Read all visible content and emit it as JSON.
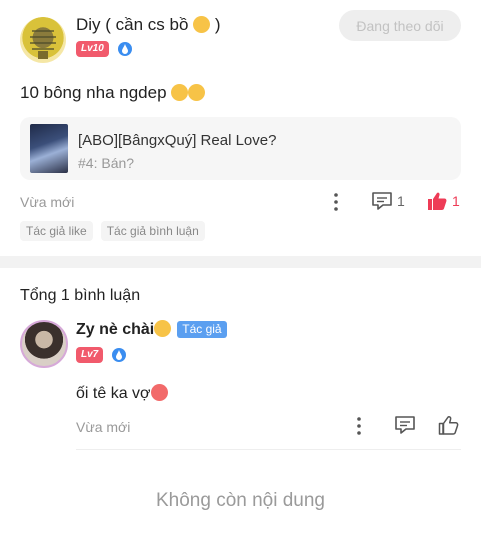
{
  "post": {
    "author_name": "Diy ( cần cs bồ",
    "author_name_suffix": ")",
    "author_level": "Lv10",
    "follow_label": "Đang theo dõi",
    "content": "10 bông nha ngdep",
    "book": {
      "title": "[ABO][BângxQuý] Real Love?",
      "chapter": "#4: Bán?"
    },
    "time": "Vừa mới",
    "comment_count": "1",
    "like_count": "1",
    "tags": [
      "Tác giả like",
      "Tác giả bình luận"
    ]
  },
  "comments_header": "Tổng 1 bình luận",
  "comment": {
    "author_name": "Zy nè chài",
    "author_tag": "Tác giả",
    "author_level": "Lv7",
    "content": "ối tê ka vợ",
    "time": "Vừa mới"
  },
  "end_text": "Không còn nội dung",
  "colors": {
    "level_badge": "#f15a6c",
    "like_active": "#ee3b56",
    "author_tag": "#5b9ff0",
    "verified": "#3a8df0"
  }
}
